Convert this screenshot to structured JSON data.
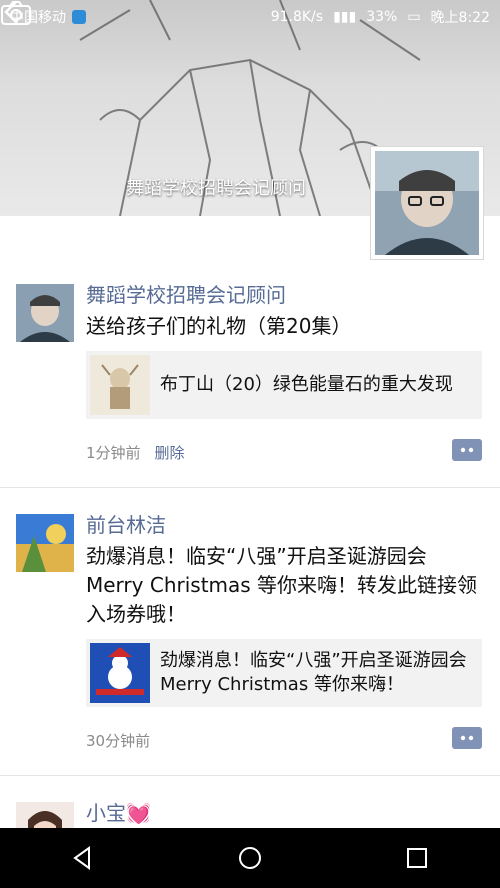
{
  "status_bar": {
    "carrier": "中国移动",
    "network_speed": "91.8K/s",
    "battery": "33%",
    "time": "晚上8:22"
  },
  "cover": {
    "owner_name": "舞蹈学校招聘会记顾问"
  },
  "posts": [
    {
      "name": "舞蹈学校招聘会记顾问",
      "text": "送给孩子们的礼物（第20集）",
      "link_title": "布丁山（20）绿色能量石的重大发现",
      "time": "1分钟前",
      "delete_label": "删除"
    },
    {
      "name": "前台林洁",
      "text": "劲爆消息！临安“八强”开启圣诞游园会Merry Christmas 等你来嗨！转发此链接领入场券哦！",
      "link_title": "劲爆消息！临安“八强”开启圣诞游园会Merry Christmas 等你来嗨！",
      "time": "30分钟前"
    },
    {
      "name": "小宝💓"
    }
  ],
  "icons": {
    "back": "chevron-left-icon",
    "camera": "camera-icon",
    "comment": "comment-more-icon",
    "nav_back": "triangle-back-icon",
    "nav_home": "circle-home-icon",
    "nav_recent": "square-recent-icon"
  },
  "colors": {
    "name_link": "#576b95",
    "comment_button": "#8093b7",
    "card_bg": "#f2f2f2"
  }
}
